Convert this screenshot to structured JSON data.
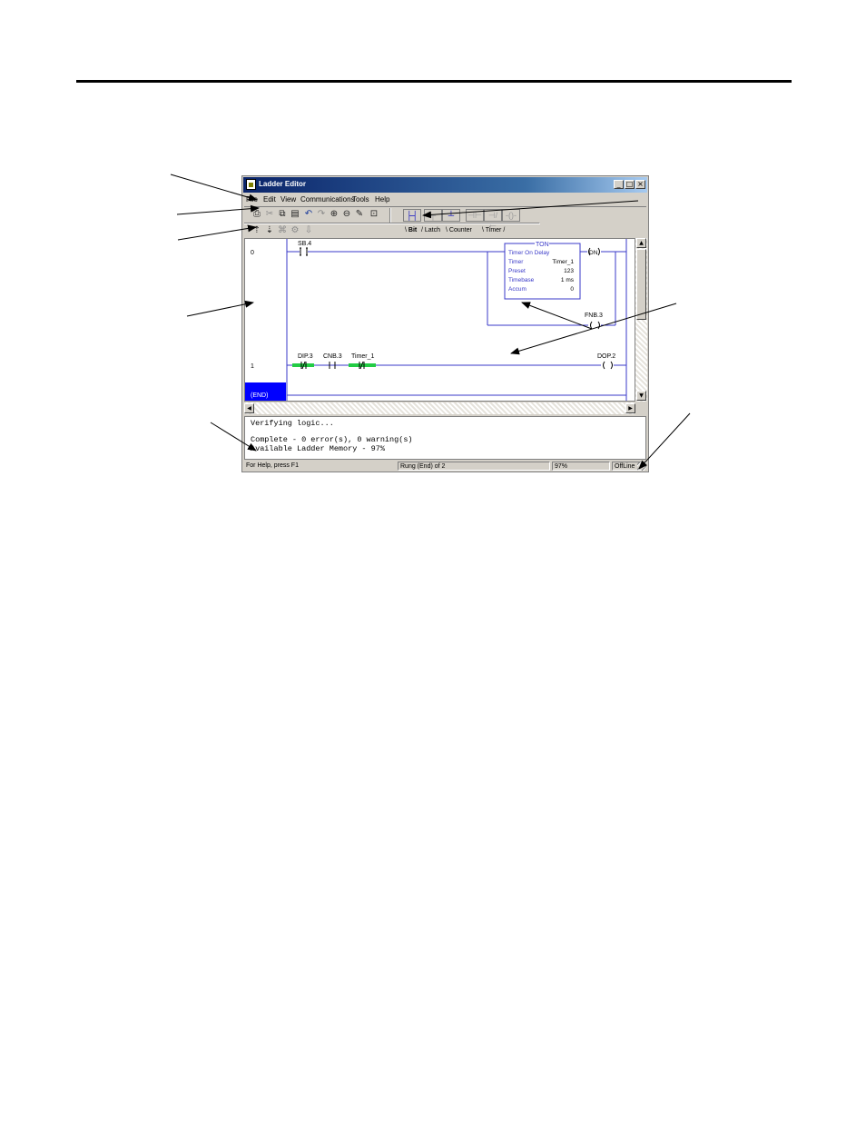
{
  "window": {
    "title": "Ladder Editor"
  },
  "menu": [
    "File",
    "Edit",
    "View",
    "Communications",
    "Tools",
    "Help"
  ],
  "toolbar_icons": [
    "print-icon",
    "cut-icon",
    "copy-icon",
    "paste-icon",
    "undo-icon",
    "redo-icon",
    "zoom-in-icon",
    "zoom-out-icon",
    "verify-icon",
    "lock-icon"
  ],
  "nav_icons": [
    "rung-up-icon",
    "rung-down-icon",
    "find-icon",
    "settings-icon",
    "download-icon"
  ],
  "instruction_tabs": [
    "Bit",
    "Latch",
    "Counter",
    "Timer"
  ],
  "ladder": {
    "rungs": [
      {
        "number": "0",
        "contact": "SB.4",
        "ton": {
          "header": "TON",
          "title": "Timer On Delay",
          "rows": [
            {
              "label": "Timer",
              "value": "Timer_1"
            },
            {
              "label": "Preset",
              "value": "123"
            },
            {
              "label": "Timebase",
              "value": "1 ms"
            },
            {
              "label": "Accum",
              "value": "0"
            }
          ],
          "output": "DN",
          "branch_coil": "FNB.3"
        }
      },
      {
        "number": "1",
        "contacts": [
          "DIP.3",
          "CNB.3",
          "Timer_1"
        ],
        "coil": "DOP.2"
      }
    ],
    "end_label": "(END)"
  },
  "output_window": {
    "lines": [
      "Verifying logic...",
      "",
      "Complete - 0 error(s), 0 warning(s)",
      "Available Ladder Memory - 97%"
    ]
  },
  "status_bar": {
    "help": "For Help, press F1",
    "rung": "Rung (End) of 2",
    "percent": "97%",
    "mode": "OffLine"
  },
  "colors": {
    "rail": "#3838c8",
    "energized": "#22cc44",
    "end_block": "#0000ff",
    "titlebar": "#0a246a"
  }
}
